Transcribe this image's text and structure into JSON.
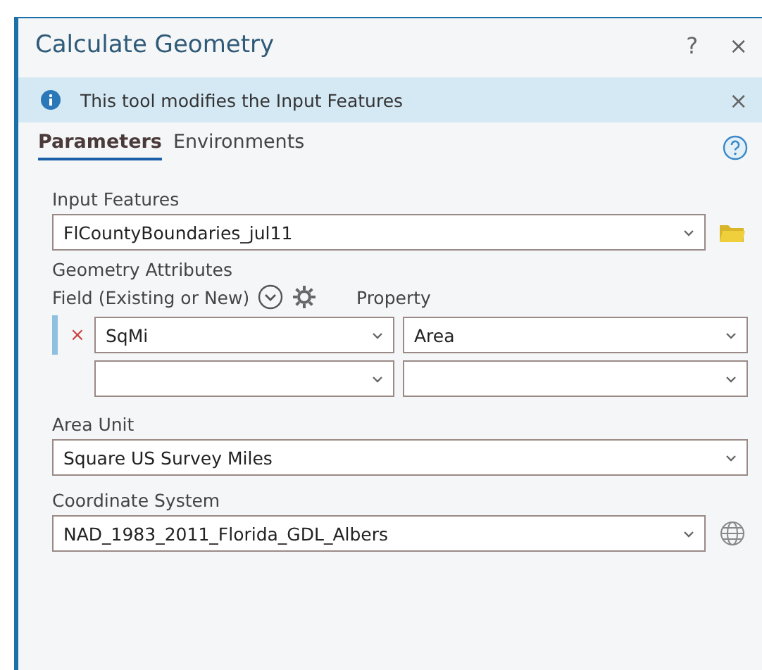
{
  "window": {
    "title": "Calculate Geometry",
    "help": "?",
    "close": "×"
  },
  "info_bar": {
    "message": "This tool modifies the Input Features",
    "close": "×"
  },
  "tabs": [
    {
      "label": "Parameters",
      "selected": true
    },
    {
      "label": "Environments",
      "selected": false
    }
  ],
  "input_features": {
    "label": "Input Features",
    "value": "FlCountyBoundaries_jul11"
  },
  "geometry_attributes": {
    "label": "Geometry Attributes",
    "field_header": "Field (Existing or New)",
    "property_header": "Property",
    "rows": [
      {
        "remove": "×",
        "field": "SqMi",
        "property": "Area",
        "selected": true
      },
      {
        "field": "",
        "property": "",
        "selected": false
      }
    ]
  },
  "area_unit": {
    "label": "Area Unit",
    "value": "Square US Survey Miles"
  },
  "coordinate_system": {
    "label": "Coordinate System",
    "value": "NAD_1983_2011_Florida_GDL_Albers"
  }
}
